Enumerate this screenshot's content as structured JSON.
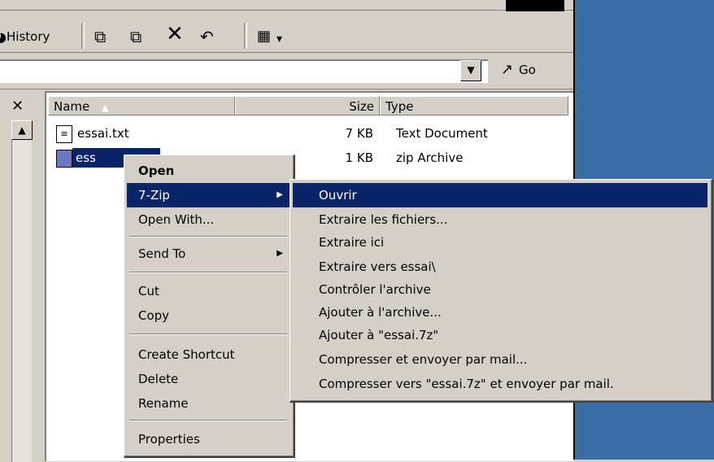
{
  "toolbar": {
    "history_label": "History",
    "view_icon": "views-icon",
    "view_arrow": "▾"
  },
  "address": {
    "go_label": "Go",
    "dropdown_arrow": "▼"
  },
  "file_list": {
    "columns": [
      "Name",
      "Size",
      "Type"
    ],
    "rows": [
      {
        "name": "essai.txt",
        "size": "7 KB",
        "type": "Text Document"
      },
      {
        "name": "essai.zip",
        "visible_name": "ess",
        "size": "1 KB",
        "type": "zip Archive"
      }
    ]
  },
  "context_menu": {
    "items": [
      {
        "label": "Open",
        "bold": true
      },
      {
        "label": "7-Zip",
        "submenu": true,
        "selected": true
      },
      {
        "label": "Open With..."
      },
      {
        "label": "Send To",
        "submenu": true
      },
      {
        "label": "Cut"
      },
      {
        "label": "Copy"
      },
      {
        "label": "Create Shortcut"
      },
      {
        "label": "Delete"
      },
      {
        "label": "Rename"
      },
      {
        "label": "Properties"
      }
    ]
  },
  "submenu": {
    "items": [
      {
        "label": "Ouvrir",
        "selected": true
      },
      {
        "label": "Extraire les fichiers..."
      },
      {
        "label": "Extraire ici"
      },
      {
        "label": "Extraire vers essai\\"
      },
      {
        "label": "Contrôler l'archive"
      },
      {
        "label": "Ajouter à l'archive..."
      },
      {
        "label": "Ajouter à \"essai.7z\""
      },
      {
        "label": "Compresser et envoyer par mail..."
      },
      {
        "label": "Compresser vers \"essai.7z\" et envoyer par mail."
      }
    ]
  },
  "colors": {
    "selection": "#0a246a",
    "desktop": "#3a6ea5",
    "chrome": "#d4d0c8"
  }
}
